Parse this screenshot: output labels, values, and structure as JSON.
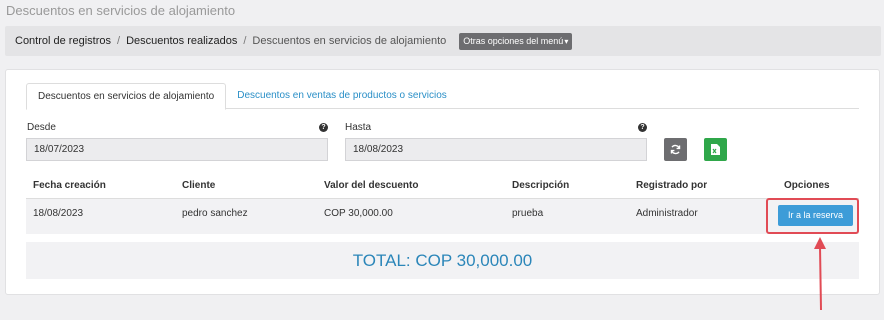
{
  "page": {
    "title": "Descuentos en servicios de alojamiento"
  },
  "breadcrumb": {
    "items": [
      "Control de registros",
      "Descuentos realizados",
      "Descuentos en servicios de alojamiento"
    ],
    "separator": "/",
    "menu_button": "Otras opciones del menú"
  },
  "tabs": [
    {
      "label": "Descuentos en servicios de alojamiento",
      "active": true
    },
    {
      "label": "Descuentos en ventas de productos o servicios",
      "active": false
    }
  ],
  "filters": {
    "from_label": "Desde",
    "from_value": "18/07/2023",
    "to_label": "Hasta",
    "to_value": "18/08/2023",
    "help_glyph": "?",
    "refresh_icon": "refresh-icon",
    "export_icon": "excel-icon"
  },
  "table": {
    "columns": [
      "Fecha creación",
      "Cliente",
      "Valor del descuento",
      "Descripción",
      "Registrado por",
      "Opciones"
    ],
    "rows": [
      {
        "fecha": "18/08/2023",
        "cliente": "pedro sanchez",
        "valor": "COP 30,000.00",
        "descripcion": "prueba",
        "registrado_por": "Administrador",
        "action_label": "Ir a la reserva"
      }
    ]
  },
  "total": {
    "text": "TOTAL: COP 30,000.00"
  },
  "colors": {
    "accent": "#3d9cd8",
    "total_text": "#2b86b9",
    "excel_green": "#2fa74a",
    "annotation_red": "#e14b55",
    "menu_gray": "#6d6d70"
  }
}
